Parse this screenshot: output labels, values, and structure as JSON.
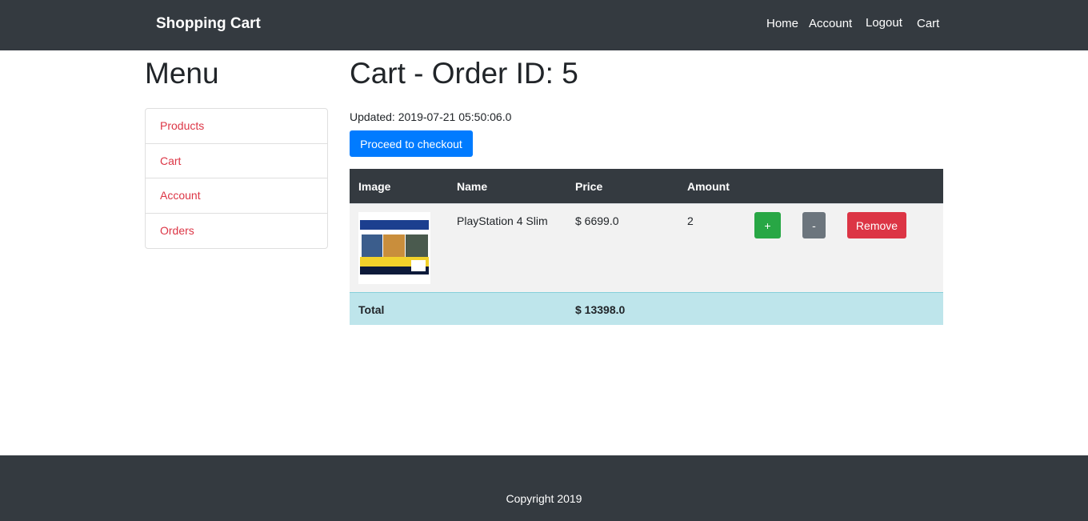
{
  "navbar": {
    "brand": "Shopping Cart",
    "links": [
      "Home",
      "Account",
      "Logout",
      "Cart"
    ]
  },
  "sidebar": {
    "title": "Menu",
    "items": [
      "Products",
      "Cart",
      "Account",
      "Orders"
    ]
  },
  "main": {
    "title": "Cart - Order ID: 5",
    "updated": "Updated: 2019-07-21 05:50:06.0",
    "checkout_label": "Proceed to checkout",
    "table": {
      "headers": [
        "Image",
        "Name",
        "Price",
        "Amount"
      ],
      "rows": [
        {
          "name": "PlayStation 4 Slim",
          "price": "$ 6699.0",
          "amount": "2",
          "plus_label": "+",
          "minus_label": "-",
          "remove_label": "Remove"
        }
      ],
      "total_label": "Total",
      "total_value": "$ 13398.0"
    }
  },
  "footer": {
    "copyright": "Copyright 2019"
  },
  "colors": {
    "navbar_bg": "#343a40",
    "primary": "#007bff",
    "success": "#28a745",
    "secondary": "#6c757d",
    "danger": "#dc3545",
    "info_light": "#bee5eb"
  }
}
